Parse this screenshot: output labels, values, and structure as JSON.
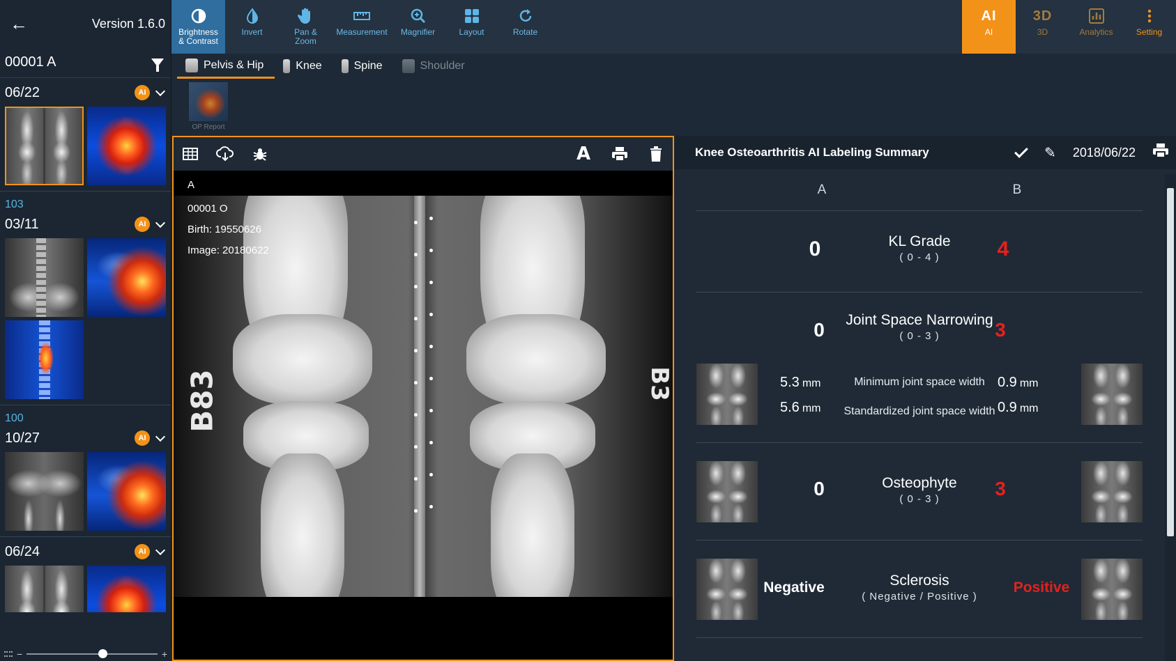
{
  "sidebar": {
    "version": "Version 1.6.0",
    "patient_id": "00001 A",
    "groups": [
      {
        "number": "",
        "date": "06/22",
        "ai": "AI"
      },
      {
        "number": "103",
        "date": "03/11",
        "ai": "AI"
      },
      {
        "number": "100",
        "date": "10/27",
        "ai": "AI"
      },
      {
        "number": "",
        "date": "06/24",
        "ai": "AI"
      }
    ],
    "zoom_level": 0.58
  },
  "toolbar": {
    "tools": [
      {
        "label_line1": "Brightness",
        "label_line2": "& Contrast",
        "icon": "brightness-icon"
      },
      {
        "label_line1": "Invert",
        "label_line2": "",
        "icon": "invert-icon"
      },
      {
        "label_line1": "Pan &",
        "label_line2": "Zoom",
        "icon": "hand-icon"
      },
      {
        "label_line1": "Measurement",
        "label_line2": "",
        "icon": "ruler-icon"
      },
      {
        "label_line1": "Magnifier",
        "label_line2": "",
        "icon": "magnifier-icon"
      },
      {
        "label_line1": "Layout",
        "label_line2": "",
        "icon": "layout-icon"
      },
      {
        "label_line1": "Rotate",
        "label_line2": "",
        "icon": "rotate-icon"
      }
    ],
    "right": {
      "ai_big": "AI",
      "ai_label": "AI",
      "threed_big": "3D",
      "threed_label": "3D",
      "analytics_label": "Analytics",
      "setting_label": "Setting"
    },
    "accent_color": "#f39219",
    "active_color": "#2f6e9e"
  },
  "part_tabs": [
    "Pelvis & Hip",
    "Knee",
    "Spine",
    "Shoulder"
  ],
  "op_report_label": "OP Report",
  "viewer": {
    "series_label": "A",
    "patient_line": "00001 O",
    "birth_line": "Birth: 19550626",
    "image_line": "Image: 20180622",
    "font_button": "A",
    "marker_left": "B83",
    "marker_right": "B3"
  },
  "summary": {
    "title": "Knee Osteoarthritis AI Labeling Summary",
    "date": "2018/06/22",
    "col_a": "A",
    "col_b": "B",
    "kl": {
      "name": "KL Grade",
      "range": "( 0 - 4 )",
      "a": "0",
      "b": "4"
    },
    "jsn": {
      "name": "Joint Space Narrowing",
      "range": "( 0 - 3 )",
      "a": "0",
      "b": "3"
    },
    "jsw": {
      "min_label": "Minimum joint space width",
      "std_label": "Standardized joint space width",
      "min_a": "5.3",
      "std_a": "5.6",
      "min_b": "0.9",
      "std_b": "0.9",
      "unit": "mm"
    },
    "osteophyte": {
      "name": "Osteophyte",
      "range": "( 0 - 3 )",
      "a": "0",
      "b": "3"
    },
    "sclerosis": {
      "name": "Sclerosis",
      "range": "( Negative / Positive )",
      "a": "Negative",
      "b": "Positive"
    },
    "positive_color": "#e5211e"
  }
}
